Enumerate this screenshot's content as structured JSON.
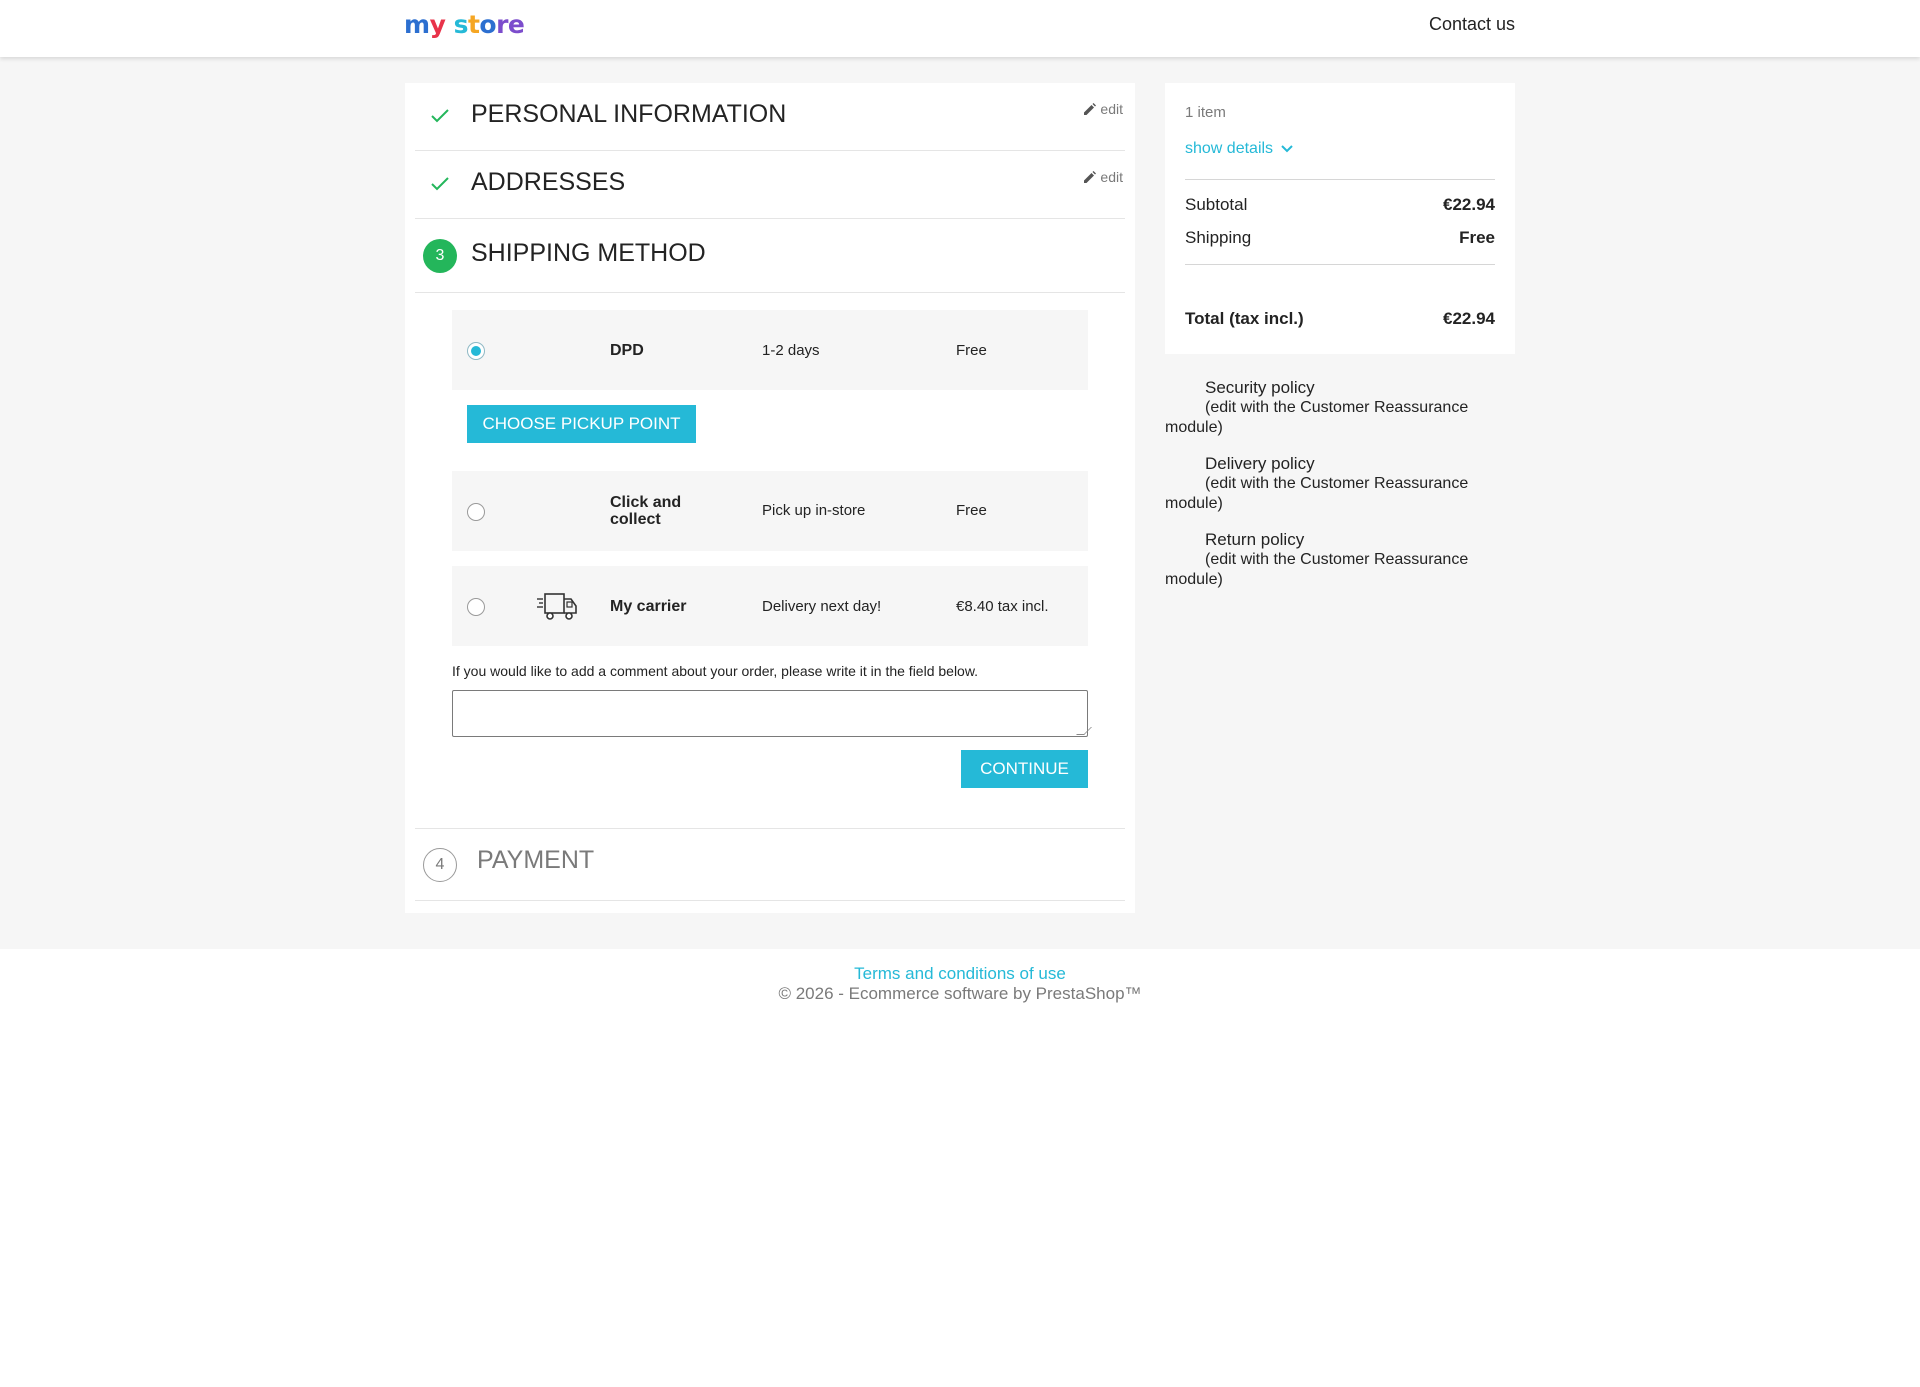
{
  "header": {
    "logo_text": [
      "m",
      "y",
      " s",
      "t",
      "o",
      "re"
    ],
    "contact_label": "Contact us"
  },
  "steps": {
    "personal": {
      "title": "PERSONAL INFORMATION",
      "edit_label": "edit"
    },
    "addresses": {
      "title": "ADDRESSES",
      "edit_label": "edit"
    },
    "shipping": {
      "number": "3",
      "title": "SHIPPING METHOD"
    },
    "payment": {
      "number": "4",
      "title": "PAYMENT"
    }
  },
  "carriers": [
    {
      "name": "DPD",
      "delay": "1-2 days",
      "price": "Free",
      "selected": true
    },
    {
      "name": "Click and collect",
      "delay": "Pick up in-store",
      "price": "Free",
      "selected": false
    },
    {
      "name": "My carrier",
      "delay": "Delivery next day!",
      "price": "€8.40 tax incl.",
      "selected": false,
      "icon": "delivery-truck-icon"
    }
  ],
  "pickup_button": "CHOOSE PICKUP POINT",
  "comment": {
    "label": "If you would like to add a comment about your order, please write it in the field below.",
    "value": ""
  },
  "continue_button": "CONTINUE",
  "summary": {
    "items_count": "1 item",
    "show_details": "show details",
    "subtotal_label": "Subtotal",
    "subtotal_value": "€22.94",
    "shipping_label": "Shipping",
    "shipping_value": "Free",
    "total_label": "Total (tax incl.)",
    "total_value": "€22.94"
  },
  "reassurance": [
    {
      "title": "Security policy",
      "desc": "(edit with the Customer Reassurance module)"
    },
    {
      "title": "Delivery policy",
      "desc": "(edit with the Customer Reassurance module)"
    },
    {
      "title": "Return policy",
      "desc": "(edit with the Customer Reassurance module)"
    }
  ],
  "footer": {
    "terms_link": "Terms and conditions of use",
    "copyright": "© 2026 - Ecommerce software by PrestaShop™"
  },
  "colors": {
    "accent": "#25b9d7",
    "success": "#24b65b",
    "background": "#f6f6f6"
  }
}
